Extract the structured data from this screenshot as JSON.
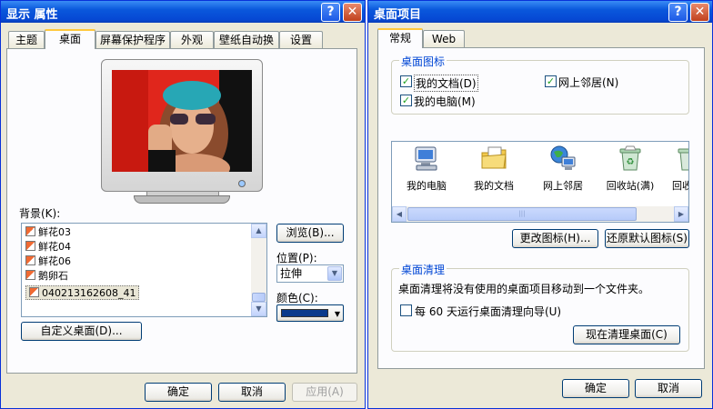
{
  "left_window": {
    "title": "显示 属性",
    "tabs": [
      {
        "label": "主题"
      },
      {
        "label": "桌面"
      },
      {
        "label": "屏幕保护程序"
      },
      {
        "label": "外观"
      },
      {
        "label": "壁纸自动换"
      },
      {
        "label": "设置"
      }
    ],
    "background_label": "背景(K):",
    "background_items": [
      {
        "name": "鲜花03"
      },
      {
        "name": "鲜花04"
      },
      {
        "name": "鲜花06"
      },
      {
        "name": "鹅卵石"
      },
      {
        "name": "040213162608_41"
      }
    ],
    "browse_button": "浏览(B)...",
    "position_label": "位置(P):",
    "position_value": "拉伸",
    "color_label": "颜色(C):",
    "color_value": "#0a3a8c",
    "customize_button": "自定义桌面(D)...",
    "ok_button": "确定",
    "cancel_button": "取消",
    "apply_button": "应用(A)"
  },
  "right_window": {
    "title": "桌面项目",
    "tabs": [
      {
        "label": "常规"
      },
      {
        "label": "Web"
      }
    ],
    "icons_group_title": "桌面图标",
    "checkboxes": {
      "my_documents": "我的文档(D)",
      "my_network": "网上邻居(N)",
      "my_computer": "我的电脑(M)"
    },
    "desktop_icons": [
      {
        "label": "我的电脑",
        "icon": "my-computer-icon"
      },
      {
        "label": "我的文档",
        "icon": "my-documents-icon"
      },
      {
        "label": "网上邻居",
        "icon": "network-places-icon"
      },
      {
        "label": "回收站(满)",
        "icon": "recycle-bin-full-icon"
      },
      {
        "label": "回收",
        "icon": "recycle-bin-icon"
      }
    ],
    "change_icon_button": "更改图标(H)...",
    "restore_default_button": "还原默认图标(S)",
    "cleanup_group_title": "桌面清理",
    "cleanup_description": "桌面清理将没有使用的桌面项目移动到一个文件夹。",
    "cleanup_check_prefix": "每",
    "cleanup_days": "60",
    "cleanup_check_suffix": "天运行桌面清理向导(U)",
    "cleanup_now_button": "现在清理桌面(C)",
    "ok_button": "确定",
    "cancel_button": "取消"
  },
  "titlebar_buttons": {
    "help": "?",
    "close": "✕"
  },
  "colors": {
    "titlebar": "#0a58dc",
    "dialog_bg": "#ece9d8",
    "accent_tab": "#ffc83c",
    "group_title": "#0046d5"
  }
}
